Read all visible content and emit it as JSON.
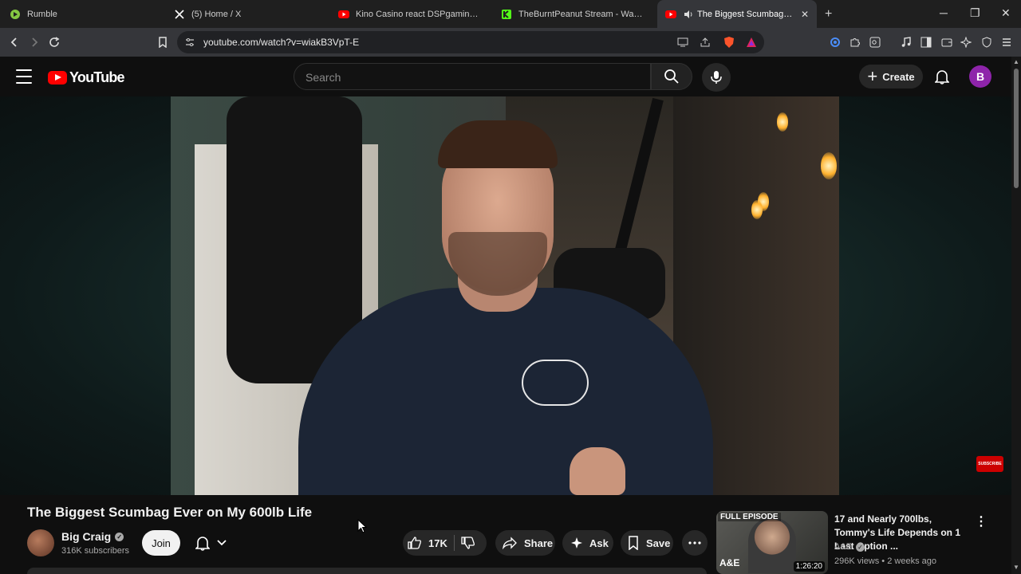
{
  "browser": {
    "tabs": [
      {
        "title": "Rumble",
        "icon": "rumble-icon"
      },
      {
        "title": "(5) Home / X",
        "icon": "x-icon"
      },
      {
        "title": "Kino Casino react DSPgamings W",
        "icon": "youtube-icon"
      },
      {
        "title": "TheBurntPeanut Stream - Watch Live",
        "icon": "kick-icon"
      },
      {
        "title": "The Biggest Scumbag Ever on",
        "icon": "youtube-icon"
      }
    ],
    "url": "youtube.com/watch?v=wiakB3VpT-E"
  },
  "masthead": {
    "logo_text": "YouTube",
    "search_placeholder": "Search",
    "create_label": "Create",
    "avatar_letter": "B"
  },
  "video": {
    "title": "The Biggest Scumbag Ever on My 600lb Life",
    "channel": "Big Craig",
    "subscribers": "316K subscribers",
    "join_label": "Join",
    "likes": "17K",
    "share_label": "Share",
    "ask_label": "Ask",
    "save_label": "Save",
    "watermark": "SUBSCRIBE"
  },
  "recommendation": {
    "title": "17 and Nearly 700lbs, Tommy's Life Depends on 1 Last Option ...",
    "channel": "A&E",
    "meta": "296K views • 2 weeks ago",
    "duration": "1:26:20",
    "thumb_label": "FULL EPISODE",
    "thumb_brand": "A&E"
  },
  "colors": {
    "brand_red": "#ff0000",
    "background": "#0f0f0f",
    "pill": "#272727",
    "avatar": "#8e24aa"
  }
}
